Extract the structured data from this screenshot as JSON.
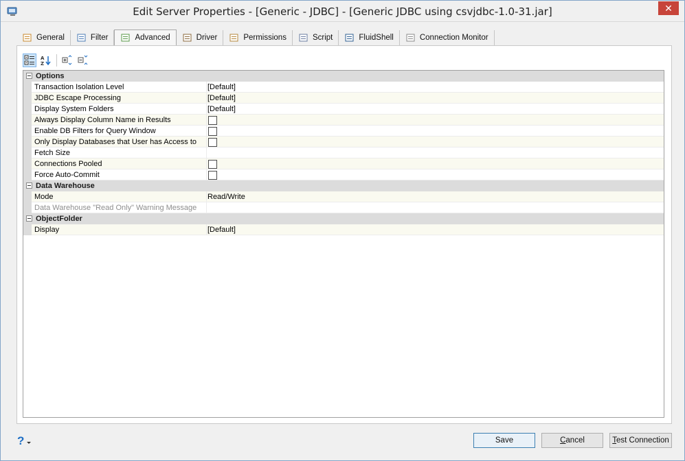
{
  "window": {
    "title": "Edit Server Properties - [Generic - JDBC] - [Generic JDBC using csvjdbc-1.0-31.jar]",
    "close_label": "✕"
  },
  "tabs": [
    {
      "label": "General",
      "icon": "general-icon"
    },
    {
      "label": "Filter",
      "icon": "filter-icon"
    },
    {
      "label": "Advanced",
      "icon": "advanced-icon",
      "active": true
    },
    {
      "label": "Driver",
      "icon": "driver-icon"
    },
    {
      "label": "Permissions",
      "icon": "permissions-icon"
    },
    {
      "label": "Script",
      "icon": "script-icon"
    },
    {
      "label": "FluidShell",
      "icon": "fluidshell-icon"
    },
    {
      "label": "Connection Monitor",
      "icon": "connection-monitor-icon"
    }
  ],
  "toolbar": {
    "buttons": [
      "categorized-icon",
      "alphabetical-icon",
      "expand-all-icon",
      "collapse-all-icon"
    ]
  },
  "grid": {
    "categories": [
      {
        "label": "Options",
        "properties": [
          {
            "name": "Transaction Isolation Level",
            "value": "[Default]"
          },
          {
            "name": "JDBC Escape Processing",
            "value": "[Default]"
          },
          {
            "name": "Display System Folders",
            "value": "[Default]"
          },
          {
            "name": "Always Display Column Name in Results",
            "checkbox": true
          },
          {
            "name": "Enable DB Filters for Query Window",
            "checkbox": true
          },
          {
            "name": "Only Display Databases that User has Access to",
            "checkbox": true
          },
          {
            "name": "Fetch Size",
            "value": ""
          },
          {
            "name": "Connections Pooled",
            "checkbox": true
          },
          {
            "name": "Force Auto-Commit",
            "checkbox": true
          }
        ]
      },
      {
        "label": "Data Warehouse",
        "properties": [
          {
            "name": "Mode",
            "value": "Read/Write"
          },
          {
            "name": "Data Warehouse \"Read Only\" Warning Message",
            "value": "",
            "disabled": true
          }
        ]
      },
      {
        "label": "ObjectFolder",
        "properties": [
          {
            "name": "Display",
            "value": "[Default]"
          }
        ]
      }
    ]
  },
  "footer": {
    "help_glyph": "?",
    "save_label": "Save",
    "cancel_mnemonic": "C",
    "cancel_rest": "ancel",
    "test_mnemonic": "T",
    "test_rest": "est Connection"
  },
  "colors": {
    "accent": "#3c7fb1",
    "close": "#c7443a",
    "category_bg": "#dcdcdc"
  }
}
